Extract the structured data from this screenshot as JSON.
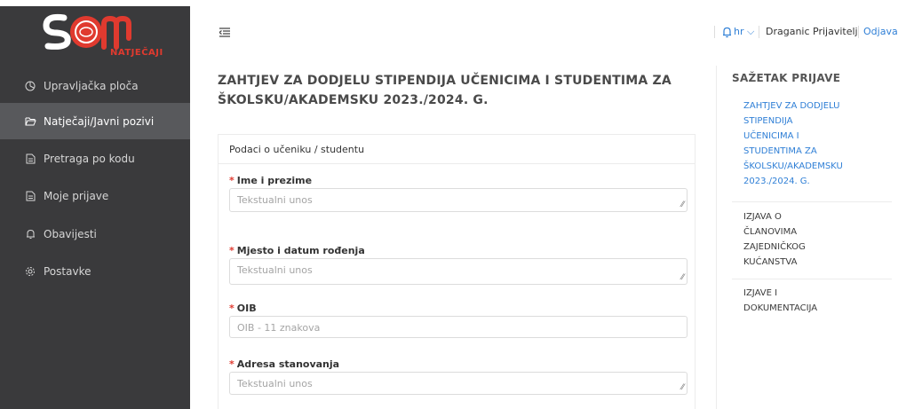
{
  "brand": {
    "logo_text": "SOM",
    "sub_text": "NATJEČAJI",
    "accent": "#e03a2f"
  },
  "sidebar": {
    "items": [
      {
        "label": "Upravljačka ploča",
        "icon": "dashboard-icon"
      },
      {
        "label": "Natječaji/Javni pozivi",
        "icon": "folder-open-icon",
        "active": true
      },
      {
        "label": "Pretraga po kodu",
        "icon": "document-icon"
      },
      {
        "label": "Moje prijave",
        "icon": "document-icon"
      },
      {
        "label": "Obavijesti",
        "icon": "bell-icon"
      },
      {
        "label": "Postavke",
        "icon": "gear-icon"
      }
    ]
  },
  "header": {
    "language": "hr",
    "user_name": "Draganic Prijavitelj",
    "logout_label": "Odjava"
  },
  "main": {
    "title_line1": "ZAHTJEV ZA DODJELU STIPENDIJA UČENICIMA I STUDENTIMA ZA",
    "title_line2": "ŠKOLSKU/AKADEMSKU 2023./2024. G.",
    "section_title": "Podaci o učeniku / studentu",
    "fields": [
      {
        "label": "Ime i prezime",
        "placeholder": "Tekstualni unos"
      },
      {
        "label": "Mjesto i datum rođenja",
        "placeholder": "Tekstualni unos"
      },
      {
        "label": "OIB",
        "placeholder": "OIB - 11 znakova"
      },
      {
        "label": "Adresa stanovanja",
        "placeholder": "Tekstualni unos"
      }
    ]
  },
  "summary": {
    "title": "SAŽETAK PRIJAVE",
    "items": [
      {
        "lines": [
          "ZAHTJEV ZA DODJELU",
          "STIPENDIJA",
          "UČENICIMA I",
          "STUDENTIMA ZA",
          "ŠKOLSKU/AKADEMSKU",
          "2023./2024. G."
        ],
        "active": true
      },
      {
        "lines": [
          "IZJAVA O",
          "ČLANOVIMA",
          "ZAJEDNIČKOG",
          "KUĆANSTVA"
        ]
      },
      {
        "lines": [
          "IZJAVE I",
          "DOKUMENTACIJA"
        ]
      }
    ]
  },
  "colors": {
    "sidebar_bg": "#3a3a3c",
    "sidebar_active": "#58595c",
    "link": "#2f7fd6",
    "required": "#e03a2f"
  }
}
